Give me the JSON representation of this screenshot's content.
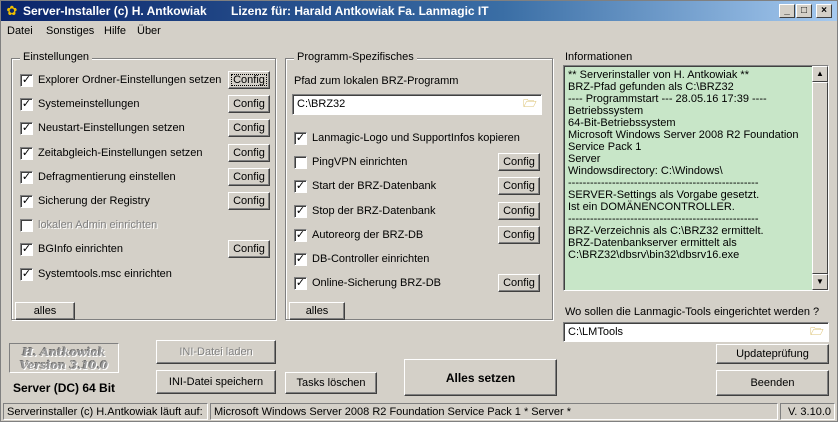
{
  "window": {
    "title": "Server-Installer (c) H. Antkowiak",
    "license": "Lizenz für:  Harald Antkowiak  Fa. Lanmagic IT",
    "minimize_glyph": "_",
    "maximize_glyph": "□",
    "close_glyph": "×",
    "app_icon": "gear-icon"
  },
  "menu": [
    "Datei",
    "Sonstiges",
    "Hilfe",
    "Über"
  ],
  "settings": {
    "title": "Einstellungen",
    "config_label": "Config",
    "all_label": "alles",
    "items": [
      {
        "label": "Explorer Ordner-Einstellungen setzen",
        "checked": true,
        "enabled": true,
        "has_config": true
      },
      {
        "label": "Systemeinstellungen",
        "checked": true,
        "enabled": true,
        "has_config": true
      },
      {
        "label": "Neustart-Einstellungen setzen",
        "checked": true,
        "enabled": true,
        "has_config": true
      },
      {
        "label": "Zeitabgleich-Einstellungen setzen",
        "checked": true,
        "enabled": true,
        "has_config": true
      },
      {
        "label": "Defragmentierung einstellen",
        "checked": true,
        "enabled": true,
        "has_config": true
      },
      {
        "label": "Sicherung der Registry",
        "checked": true,
        "enabled": true,
        "has_config": true
      },
      {
        "label": "lokalen Admin einrichten",
        "checked": false,
        "enabled": false,
        "has_config": false
      },
      {
        "label": "BGInfo einrichten",
        "checked": true,
        "enabled": true,
        "has_config": true
      },
      {
        "label": "Systemtools.msc einrichten",
        "checked": true,
        "enabled": true,
        "has_config": false
      }
    ]
  },
  "program": {
    "title": "Programm-Spezifisches",
    "path_label": "Pfad zum lokalen BRZ-Programm",
    "path_value": "C:\\BRZ32",
    "config_label": "Config",
    "all_label": "alles",
    "items": [
      {
        "label": "Lanmagic-Logo und SupportInfos kopieren",
        "checked": true,
        "has_config": false
      },
      {
        "label": "PingVPN einrichten",
        "checked": false,
        "has_config": true
      },
      {
        "label": "Start der BRZ-Datenbank",
        "checked": true,
        "has_config": true
      },
      {
        "label": "Stop der BRZ-Datenbank",
        "checked": true,
        "has_config": true
      },
      {
        "label": "Autoreorg der BRZ-DB",
        "checked": true,
        "has_config": true
      },
      {
        "label": "DB-Controller einrichten",
        "checked": true,
        "has_config": false
      },
      {
        "label": "Online-Sicherung BRZ-DB",
        "checked": true,
        "has_config": true
      }
    ]
  },
  "info": {
    "title": "Informationen",
    "lines": [
      "  **  Serverinstaller von H. Antkowiak  **",
      "BRZ-Pfad gefunden als C:\\BRZ32",
      "---- Programmstart --- 28.05.16  17:39 ----",
      "Betriebssystem",
      "  64-Bit-Betriebssystem",
      "Microsoft Windows Server 2008 R2 Foundation",
      "Service Pack 1",
      "   Server",
      "Windowsdirectory:   C:\\Windows\\",
      "----------------------------------------------------",
      "SERVER-Settings als Vorgabe gesetzt.",
      "Ist ein DOMÄNENCONTROLLER.",
      "----------------------------------------------------",
      "BRZ-Verzeichnis als C:\\BRZ32 ermittelt.",
      "BRZ-Datenbankserver ermittelt als",
      "   C:\\BRZ32\\dbsrv\\bin32\\dbsrv16.exe"
    ],
    "background": "#c8e6c8"
  },
  "tools": {
    "question": "Wo sollen die Lanmagic-Tools eingerichtet werden ?",
    "path_value": "C:\\LMTools"
  },
  "logo": {
    "line1": "H. Antkowiak",
    "line2": "Version  3.10.0"
  },
  "server_label": "Server (DC) 64 Bit",
  "buttons": {
    "ini_load": "INI-Datei laden",
    "ini_save": "INI-Datei speichern",
    "tasks_delete": "Tasks löschen",
    "set_all": "Alles setzen",
    "update_check": "Updateprüfung",
    "exit": "Beenden"
  },
  "status": {
    "left": "Serverinstaller (c) H.Antkowiak läuft auf:",
    "middle": "Microsoft Windows Server 2008 R2 Foundation  Service Pack 1   * Server *",
    "right": "V. 3.10.0"
  }
}
